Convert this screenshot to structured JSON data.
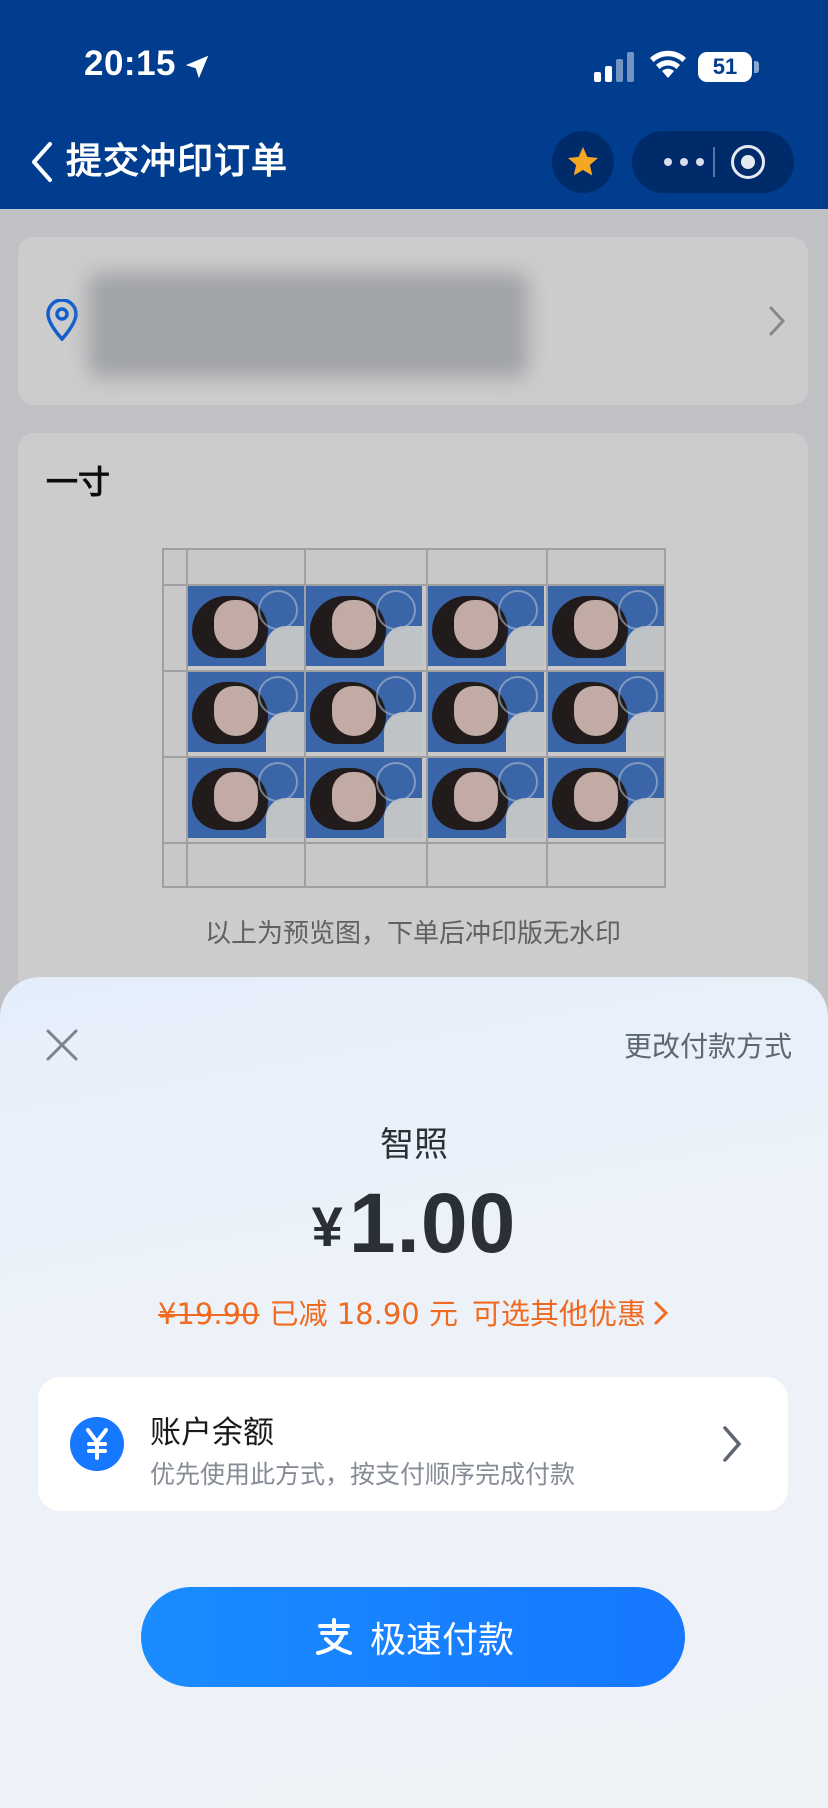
{
  "status_bar": {
    "time": "20:15",
    "battery": "51"
  },
  "nav": {
    "title": "提交冲印订单"
  },
  "photo_card": {
    "size_label": "一寸",
    "preview_note": "以上为预览图，下单后冲印版无水印",
    "grid": {
      "rows": 3,
      "cols": 4
    }
  },
  "payment": {
    "change_method": "更改付款方式",
    "merchant": "智照",
    "currency_symbol": "¥",
    "amount": "1.00",
    "original_price": "¥19.90",
    "saved_text": "已减 18.90 元",
    "more_offers": "可选其他优惠",
    "method": {
      "title": "账户余额",
      "subtitle": "优先使用此方式，按支付顺序完成付款",
      "icon_text": "¥"
    },
    "pay_button": "极速付款"
  },
  "colors": {
    "nav_bg": "#003d8f",
    "accent": "#1677ff",
    "discount": "#f06a20",
    "star": "#f5a623"
  }
}
